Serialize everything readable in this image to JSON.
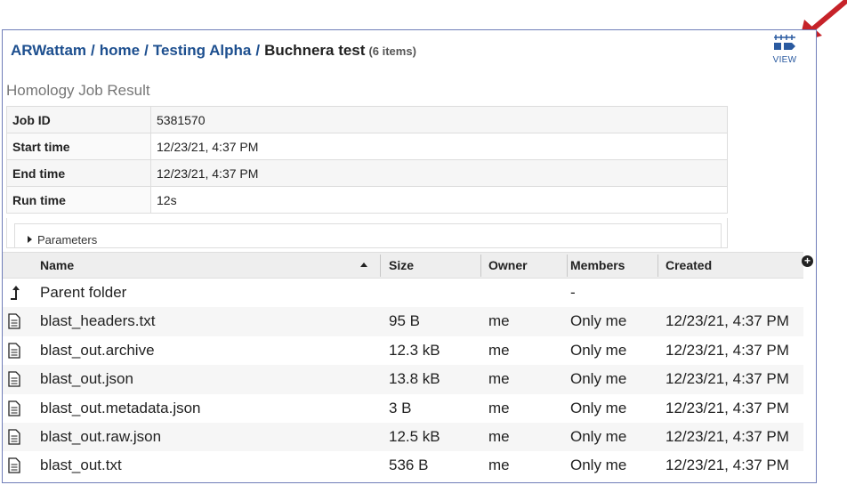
{
  "breadcrumb": {
    "items": [
      "ARWattam",
      "home",
      "Testing Alpha"
    ],
    "separator": "/",
    "current": "Buchnera test",
    "count": "(6 items)"
  },
  "view_button": {
    "label": "VIEW",
    "icon": "view-toggle-icon"
  },
  "job": {
    "title": "Homology Job Result",
    "fields": [
      {
        "key": "Job ID",
        "value": "5381570"
      },
      {
        "key": "Start time",
        "value": "12/23/21, 4:37 PM"
      },
      {
        "key": "End time",
        "value": "12/23/21, 4:37 PM"
      },
      {
        "key": "Run time",
        "value": "12s"
      }
    ],
    "parameters_label": "Parameters"
  },
  "grid": {
    "columns": [
      "Name",
      "Size",
      "Owner",
      "Members",
      "Created"
    ],
    "add_column_icon": "+",
    "rows": [
      {
        "icon": "parent-folder-icon",
        "name": "Parent folder",
        "size": "",
        "owner": "",
        "members": "-",
        "created": ""
      },
      {
        "icon": "file-icon",
        "name": "blast_headers.txt",
        "size": "95 B",
        "owner": "me",
        "members": "Only me",
        "created": "12/23/21, 4:37 PM"
      },
      {
        "icon": "file-icon",
        "name": "blast_out.archive",
        "size": "12.3 kB",
        "owner": "me",
        "members": "Only me",
        "created": "12/23/21, 4:37 PM"
      },
      {
        "icon": "file-icon",
        "name": "blast_out.json",
        "size": "13.8 kB",
        "owner": "me",
        "members": "Only me",
        "created": "12/23/21, 4:37 PM"
      },
      {
        "icon": "file-icon",
        "name": "blast_out.metadata.json",
        "size": "3 B",
        "owner": "me",
        "members": "Only me",
        "created": "12/23/21, 4:37 PM"
      },
      {
        "icon": "file-icon",
        "name": "blast_out.raw.json",
        "size": "12.5 kB",
        "owner": "me",
        "members": "Only me",
        "created": "12/23/21, 4:37 PM"
      },
      {
        "icon": "file-icon",
        "name": "blast_out.txt",
        "size": "536 B",
        "owner": "me",
        "members": "Only me",
        "created": "12/23/21, 4:37 PM"
      }
    ]
  },
  "colors": {
    "link": "#1d4f8f",
    "panel_border": "#6f7db8",
    "arrow": "#c62229"
  }
}
